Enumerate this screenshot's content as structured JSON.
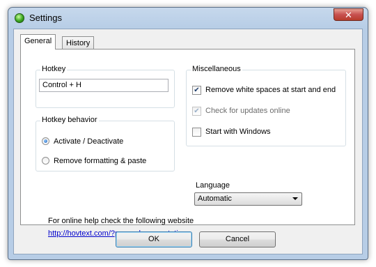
{
  "window": {
    "title": "Settings",
    "close_glyph": "✕"
  },
  "tabs": [
    {
      "label": "General",
      "active": true
    },
    {
      "label": "History",
      "active": false
    }
  ],
  "hotkey": {
    "legend": "Hotkey",
    "value": "Control + H"
  },
  "hotkey_behavior": {
    "legend": "Hotkey behavior",
    "options": [
      {
        "label": "Activate / Deactivate",
        "selected": true
      },
      {
        "label": "Remove formatting & paste",
        "selected": false
      }
    ]
  },
  "misc": {
    "legend": "Miscellaneous",
    "options": [
      {
        "label": "Remove white spaces at start and end",
        "checked": true,
        "enabled": true
      },
      {
        "label": "Check for updates online",
        "checked": true,
        "enabled": false
      },
      {
        "label": "Start with Windows",
        "checked": false,
        "enabled": true
      }
    ]
  },
  "language": {
    "label": "Language",
    "selected": "Automatic"
  },
  "help": {
    "text": "For online help check the following website",
    "link": "http://hovtext.com/?page=documentation"
  },
  "buttons": {
    "ok": "OK",
    "cancel": "Cancel"
  },
  "icons": {
    "app": "green-orb-icon",
    "close": "close-icon",
    "dropdown": "chevron-down-icon",
    "check": "checkmark-icon"
  },
  "colors": {
    "title_bar": "#b7cde6",
    "close_button": "#c75050",
    "link": "#0000cc"
  }
}
